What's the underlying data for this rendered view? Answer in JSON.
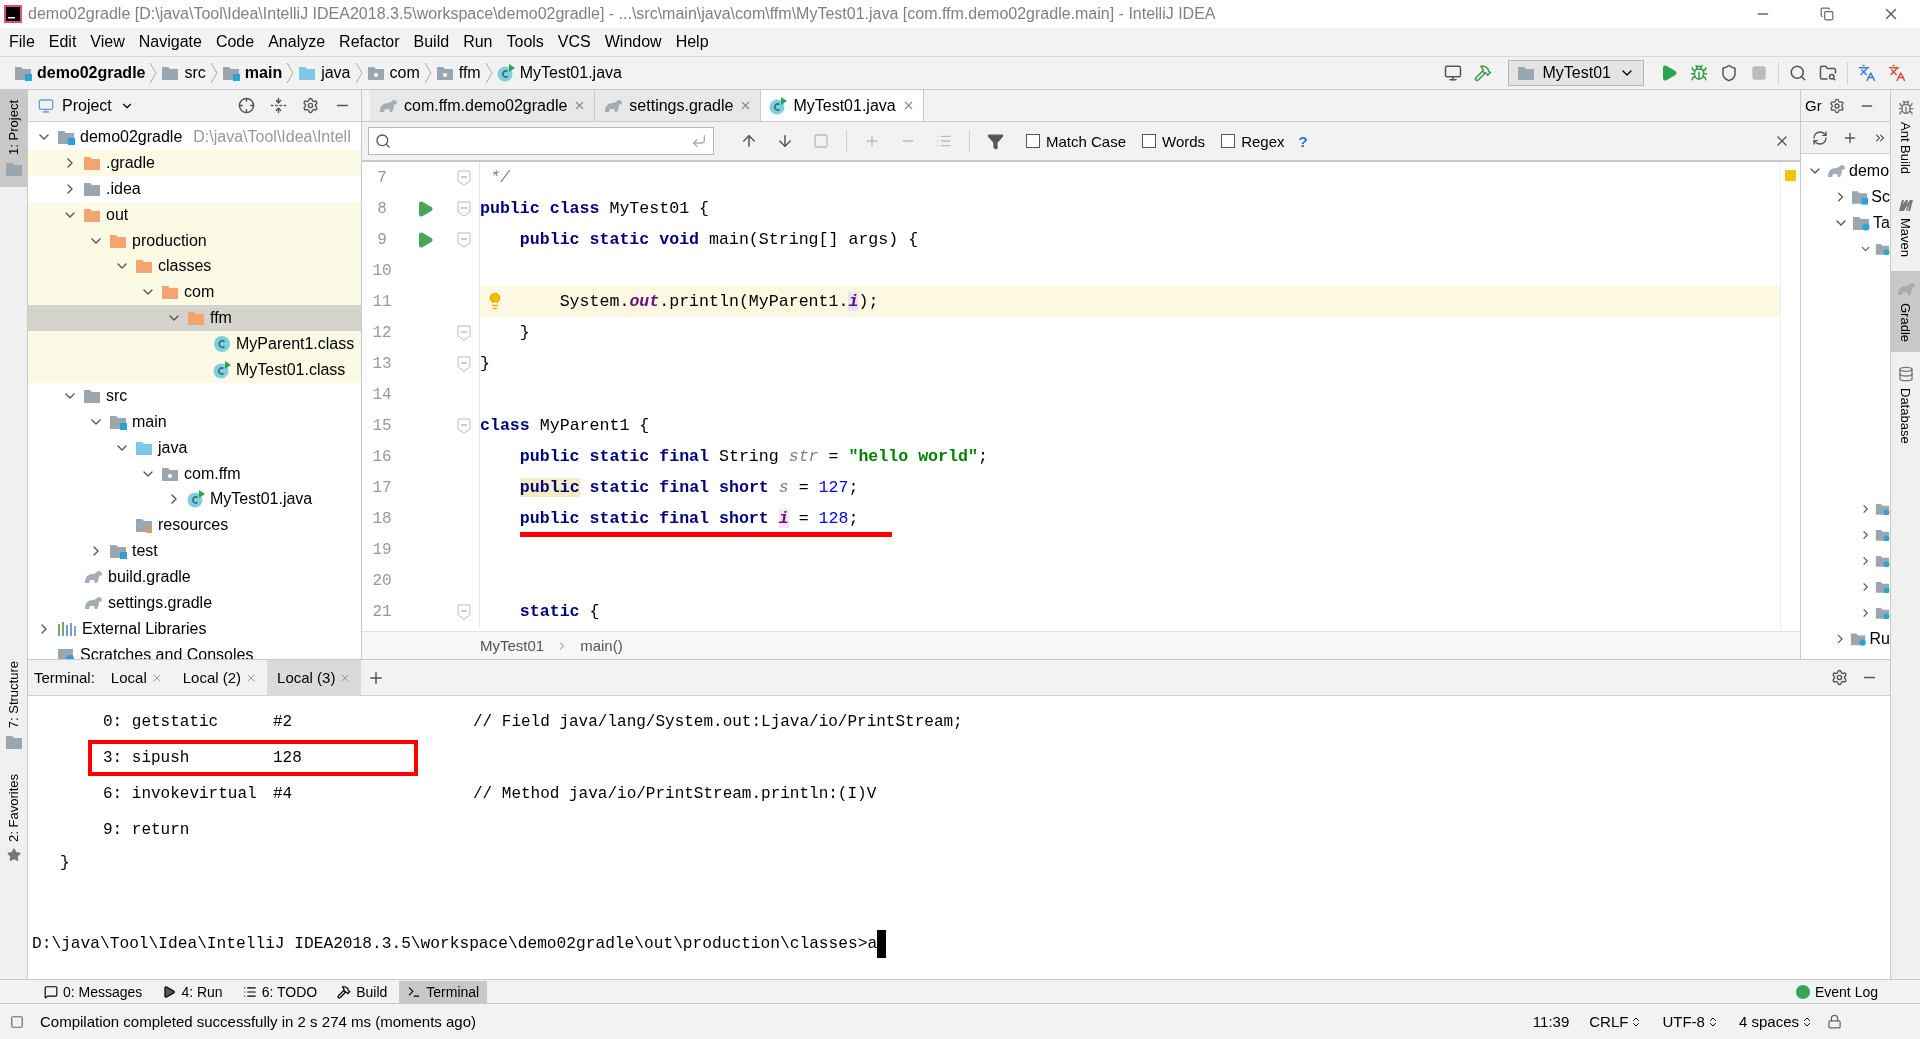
{
  "window": {
    "title": "demo02gradle [D:\\java\\Tool\\Idea\\IntelliJ IDEA2018.3.5\\workspace\\demo02gradle] - ...\\src\\main\\java\\com\\ffm\\MyTest01.java [com.ffm.demo02gradle.main] - IntelliJ IDEA"
  },
  "menu": [
    "File",
    "Edit",
    "View",
    "Navigate",
    "Code",
    "Analyze",
    "Refactor",
    "Build",
    "Run",
    "Tools",
    "VCS",
    "Window",
    "Help"
  ],
  "breadcrumbs": [
    {
      "label": "demo02gradle",
      "kind": "module",
      "bold": true
    },
    {
      "label": "src",
      "kind": "folder",
      "bold": false
    },
    {
      "label": "main",
      "kind": "module",
      "bold": true
    },
    {
      "label": "java",
      "kind": "source",
      "bold": false
    },
    {
      "label": "com",
      "kind": "package",
      "bold": false
    },
    {
      "label": "ffm",
      "kind": "package",
      "bold": false
    },
    {
      "label": "MyTest01.java",
      "kind": "runnable",
      "bold": false
    }
  ],
  "run_config": {
    "label": "MyTest01"
  },
  "left_stripe": [
    {
      "label": "1: Project",
      "selected": true
    },
    {
      "label": "7: Structure",
      "selected": false
    },
    {
      "label": "2: Favorites",
      "selected": false
    }
  ],
  "project_panel": {
    "title": "Project",
    "tree": [
      {
        "label": "demo02gradle",
        "hint": "D:\\java\\Tool\\Idea\\Intell",
        "kind": "module",
        "expanded": true,
        "selected": false,
        "excluded": false,
        "children": [
          {
            "label": ".gradle",
            "kind": "folder",
            "expanded": false,
            "selected": false,
            "excluded": true
          },
          {
            "label": ".idea",
            "kind": "folder",
            "expanded": false,
            "selected": false,
            "excluded": false
          },
          {
            "label": "out",
            "kind": "folder",
            "expanded": true,
            "selected": false,
            "excluded": true,
            "children": [
              {
                "label": "production",
                "kind": "folder",
                "expanded": true,
                "selected": false,
                "excluded": true,
                "children": [
                  {
                    "label": "classes",
                    "kind": "folder",
                    "expanded": true,
                    "selected": false,
                    "excluded": true,
                    "children": [
                      {
                        "label": "com",
                        "kind": "folder",
                        "expanded": true,
                        "selected": false,
                        "excluded": true,
                        "children": [
                          {
                            "label": "ffm",
                            "kind": "folder",
                            "expanded": true,
                            "selected": true,
                            "excluded": true,
                            "children": [
                              {
                                "label": "MyParent1.class",
                                "kind": "class",
                                "selected": false,
                                "excluded": true
                              },
                              {
                                "label": "MyTest01.class",
                                "kind": "runnable",
                                "selected": false,
                                "excluded": true
                              }
                            ]
                          }
                        ]
                      }
                    ]
                  }
                ]
              }
            ]
          },
          {
            "label": "src",
            "kind": "folder",
            "expanded": true,
            "selected": false,
            "excluded": false,
            "children": [
              {
                "label": "main",
                "kind": "module",
                "expanded": true,
                "selected": false,
                "excluded": false,
                "children": [
                  {
                    "label": "java",
                    "kind": "source",
                    "expanded": true,
                    "selected": false,
                    "excluded": false,
                    "children": [
                      {
                        "label": "com.ffm",
                        "kind": "package",
                        "expanded": true,
                        "selected": false,
                        "excluded": false,
                        "children": [
                          {
                            "label": "MyTest01.java",
                            "kind": "runnable",
                            "expanded": false,
                            "selected": false,
                            "excluded": false
                          }
                        ]
                      }
                    ]
                  },
                  {
                    "label": "resources",
                    "kind": "resources",
                    "selected": false,
                    "excluded": false
                  }
                ]
              },
              {
                "label": "test",
                "kind": "module",
                "expanded": false,
                "selected": false,
                "excluded": false
              }
            ]
          },
          {
            "label": "build.gradle",
            "kind": "gradle",
            "selected": false,
            "excluded": false
          },
          {
            "label": "settings.gradle",
            "kind": "gradle",
            "selected": false,
            "excluded": false
          }
        ]
      },
      {
        "label": "External Libraries",
        "kind": "libraries",
        "expanded": false,
        "selected": false,
        "excluded": false
      },
      {
        "label": "Scratches and Consoles",
        "kind": "scratches",
        "selected": false,
        "excluded": false
      }
    ]
  },
  "editor": {
    "tabs": [
      {
        "label": "com.ffm.demo02gradle",
        "kind": "gradle",
        "selected": false
      },
      {
        "label": "settings.gradle",
        "kind": "gradle",
        "selected": false
      },
      {
        "label": "MyTest01.java",
        "kind": "runnable",
        "selected": true
      }
    ],
    "find": {
      "options": [
        {
          "label": "Match Case",
          "checked": false
        },
        {
          "label": "Words",
          "checked": false
        },
        {
          "label": "Regex",
          "checked": false
        }
      ],
      "help": "?"
    },
    "lines": [
      {
        "num": "7",
        "run": false,
        "fold": true,
        "current": false,
        "bulb": false,
        "underline": false,
        "tokens": [
          {
            "kind": "comment",
            "text": " */"
          }
        ]
      },
      {
        "num": "8",
        "run": true,
        "fold": true,
        "current": false,
        "bulb": false,
        "underline": false,
        "tokens": [
          {
            "kind": "keyword",
            "text": "public class"
          },
          {
            "kind": "plain",
            "text": " MyTest01 {"
          }
        ]
      },
      {
        "num": "9",
        "run": true,
        "fold": true,
        "current": false,
        "bulb": false,
        "underline": false,
        "tokens": [
          {
            "kind": "keyword",
            "text": "    public static void"
          },
          {
            "kind": "plain",
            "text": " main(String[] args) {"
          }
        ]
      },
      {
        "num": "10",
        "run": false,
        "fold": false,
        "current": false,
        "bulb": false,
        "underline": false
      },
      {
        "num": "11",
        "run": false,
        "fold": false,
        "current": true,
        "bulb": true,
        "underline": false,
        "tokens": [
          {
            "kind": "plain",
            "text": "        System."
          },
          {
            "kind": "static-field",
            "text": "out"
          },
          {
            "kind": "plain",
            "text": ".println(MyParent1."
          },
          {
            "kind": "field-usage",
            "text": "i"
          },
          {
            "kind": "plain",
            "text": ");"
          }
        ]
      },
      {
        "num": "12",
        "run": false,
        "fold": true,
        "current": false,
        "bulb": false,
        "underline": false,
        "tokens": [
          {
            "kind": "plain",
            "text": "    }"
          }
        ]
      },
      {
        "num": "13",
        "run": false,
        "fold": true,
        "current": false,
        "bulb": false,
        "underline": false,
        "tokens": [
          {
            "kind": "plain",
            "text": "}"
          }
        ]
      },
      {
        "num": "14",
        "run": false,
        "fold": false,
        "current": false,
        "bulb": false,
        "underline": false
      },
      {
        "num": "15",
        "run": false,
        "fold": true,
        "current": false,
        "bulb": false,
        "underline": false,
        "tokens": [
          {
            "kind": "keyword",
            "text": "class"
          },
          {
            "kind": "plain",
            "text": " MyParent1 {"
          }
        ]
      },
      {
        "num": "16",
        "run": false,
        "fold": false,
        "current": false,
        "bulb": false,
        "underline": false,
        "tokens": [
          {
            "kind": "keyword",
            "text": "    public static final"
          },
          {
            "kind": "plain",
            "text": " String "
          },
          {
            "kind": "unused-field",
            "text": "str"
          },
          {
            "kind": "plain",
            "text": " = "
          },
          {
            "kind": "string",
            "text": "\"hello world\""
          },
          {
            "kind": "plain",
            "text": ";"
          }
        ]
      },
      {
        "num": "17",
        "run": false,
        "fold": false,
        "current": false,
        "bulb": false,
        "underline": false,
        "tokens": [
          {
            "kind": "keyword-marked",
            "text": "    public"
          },
          {
            "kind": "keyword",
            "text": " static final short "
          },
          {
            "kind": "unused-field",
            "text": "s"
          },
          {
            "kind": "plain",
            "text": " = "
          },
          {
            "kind": "number",
            "text": "127"
          },
          {
            "kind": "plain",
            "text": ";"
          }
        ]
      },
      {
        "num": "18",
        "run": false,
        "fold": false,
        "current": false,
        "bulb": false,
        "underline": true,
        "tokens": [
          {
            "kind": "keyword",
            "text": "    public static final short "
          },
          {
            "kind": "field-declaration",
            "text": "i"
          },
          {
            "kind": "plain",
            "text": " = "
          },
          {
            "kind": "number",
            "text": "128"
          },
          {
            "kind": "plain",
            "text": ";"
          }
        ]
      },
      {
        "num": "19",
        "run": false,
        "fold": false,
        "current": false,
        "bulb": false,
        "underline": false
      },
      {
        "num": "20",
        "run": false,
        "fold": false,
        "current": false,
        "bulb": false,
        "underline": false
      },
      {
        "num": "21",
        "run": false,
        "fold": true,
        "current": false,
        "bulb": false,
        "underline": false,
        "tokens": [
          {
            "kind": "keyword",
            "text": "    static"
          },
          {
            "kind": "plain",
            "text": " {"
          }
        ]
      }
    ],
    "crumbs": [
      "MyTest01",
      "main()"
    ]
  },
  "gradle_panel": {
    "title": "Gr",
    "tree": [
      {
        "label": "demo",
        "kind": "gradle",
        "expanded": true,
        "children": [
          {
            "label": "Sc",
            "kind": "modules",
            "expanded": false
          },
          {
            "label": "Ta",
            "kind": "tasks",
            "expanded": true,
            "children": [
              {
                "kind": "tasks",
                "expanded": true
              },
              {
                "kind": "tasks",
                "expanded": false
              },
              {
                "kind": "tasks",
                "expanded": false
              },
              {
                "kind": "tasks",
                "expanded": false
              },
              {
                "kind": "tasks",
                "expanded": false
              },
              {
                "kind": "tasks",
                "expanded": false
              }
            ]
          },
          {
            "label": "Ru",
            "kind": "tasks",
            "expanded": false
          }
        ]
      }
    ]
  },
  "right_stripe": [
    {
      "label": "Ant Build",
      "kind": "ant",
      "selected": false
    },
    {
      "label": "Maven",
      "kind": "maven",
      "selected": false
    },
    {
      "label": "Gradle",
      "kind": "gradle",
      "selected": true
    },
    {
      "label": "Database",
      "kind": "database",
      "selected": false
    }
  ],
  "terminal": {
    "title": "Terminal:",
    "tabs": [
      {
        "label": "Local",
        "selected": false
      },
      {
        "label": "Local (2)",
        "selected": false
      },
      {
        "label": "Local (3)",
        "selected": true
      }
    ],
    "lines": [
      {
        "op": "0: getstatic",
        "arg": "#2",
        "comment": "// Field java/lang/System.out:Ljava/io/PrintStream;",
        "marked": false
      },
      {
        "op": "3: sipush",
        "arg": "128",
        "marked": true
      },
      {
        "op": "6: invokevirtual",
        "arg": "#4",
        "comment": "// Method java/io/PrintStream.println:(I)V",
        "marked": false
      },
      {
        "op": "9: return",
        "marked": false
      }
    ],
    "closing": "}",
    "prompt": "D:\\java\\Tool\\Idea\\IntelliJ IDEA2018.3.5\\workspace\\demo02gradle\\out\\production\\classes>a"
  },
  "tool_tabs": [
    {
      "label": "0: Messages",
      "kind": "messages",
      "selected": false
    },
    {
      "label": "4: Run",
      "kind": "run",
      "selected": false
    },
    {
      "label": "6: TODO",
      "kind": "todo",
      "selected": false
    },
    {
      "label": "Build",
      "kind": "build",
      "selected": false
    },
    {
      "label": "Terminal",
      "kind": "terminal",
      "selected": true
    }
  ],
  "event_log": {
    "label": "Event Log"
  },
  "status": {
    "message": "Compilation completed successfully in 2 s 274 ms (moments ago)",
    "items": [
      {
        "label": "11:39",
        "kind": "plain"
      },
      {
        "label": "CRLF",
        "kind": "dropdown"
      },
      {
        "label": "UTF-8",
        "kind": "dropdown"
      },
      {
        "label": "4 spaces",
        "kind": "dropdown"
      }
    ]
  }
}
